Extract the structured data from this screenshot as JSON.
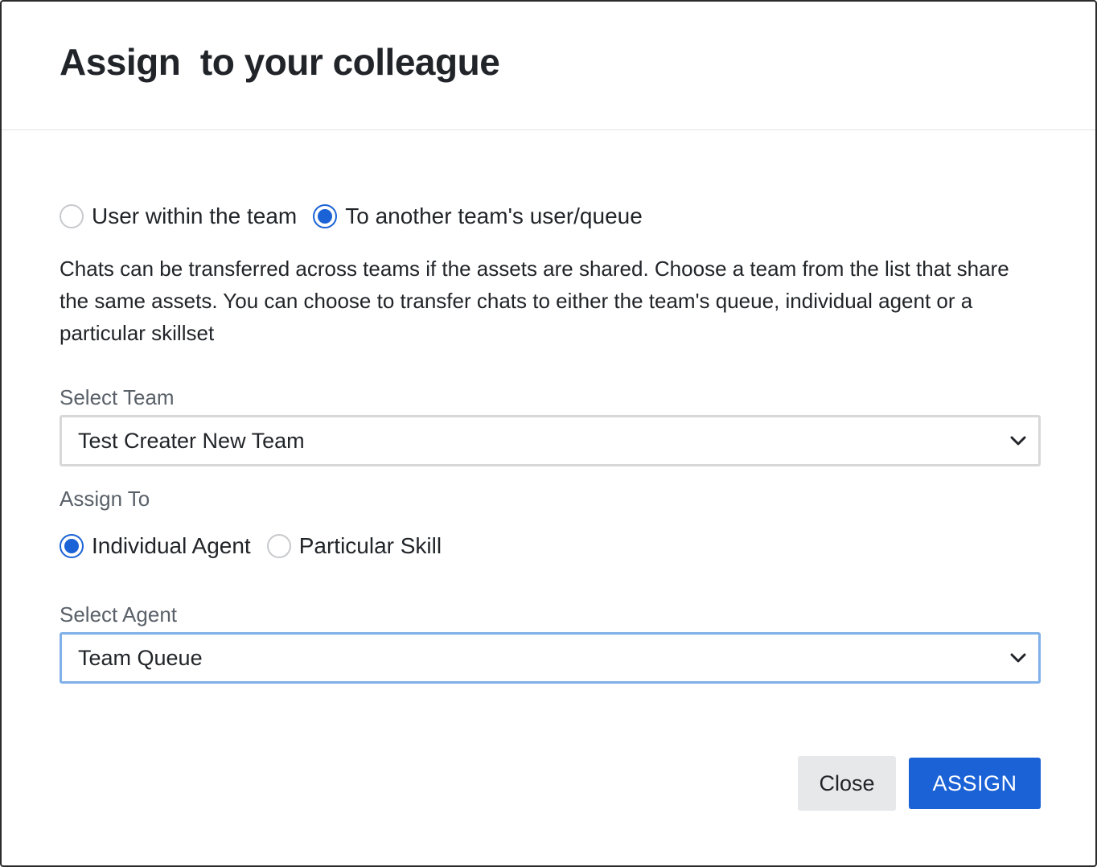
{
  "header": {
    "title": "Assign  to your colleague"
  },
  "transfer_type": {
    "options": [
      {
        "label": "User within the team",
        "checked": false
      },
      {
        "label": "To another team's user/queue",
        "checked": true
      }
    ]
  },
  "description": "Chats can be transferred across teams if the assets are shared. Choose a team from the list that share the same assets. You can choose to transfer chats to either the team's queue, individual agent or a particular skillset",
  "select_team": {
    "label": "Select Team",
    "value": "Test Creater New Team"
  },
  "assign_to": {
    "label": "Assign To",
    "options": [
      {
        "label": "Individual Agent",
        "checked": true
      },
      {
        "label": "Particular Skill",
        "checked": false
      }
    ]
  },
  "select_agent": {
    "label": "Select Agent",
    "value": "Team Queue"
  },
  "footer": {
    "close_label": "Close",
    "assign_label": "ASSIGN"
  },
  "colors": {
    "accent": "#1a62d6",
    "focus_border": "#7fb0e8",
    "close_bg": "#e7e8e9"
  },
  "icons": {
    "dropdown": "chevron-down-icon"
  }
}
